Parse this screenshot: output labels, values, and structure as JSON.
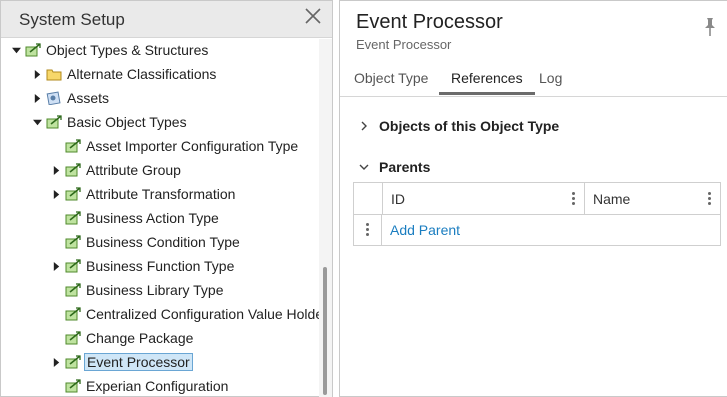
{
  "left": {
    "title": "System Setup",
    "tree": [
      {
        "label": "Object Types & Structures",
        "caret": "down",
        "icon": "object-type-icon"
      },
      {
        "label": "Alternate Classifications",
        "caret": "right",
        "icon": "folder-icon"
      },
      {
        "label": "Assets",
        "caret": "right",
        "icon": "assets-icon"
      },
      {
        "label": "Basic Object Types",
        "caret": "down",
        "icon": "object-type-icon"
      },
      {
        "label": "Asset Importer Configuration Type",
        "caret": "none",
        "icon": "object-type-icon"
      },
      {
        "label": "Attribute Group",
        "caret": "right",
        "icon": "object-type-icon"
      },
      {
        "label": "Attribute Transformation",
        "caret": "right",
        "icon": "object-type-icon"
      },
      {
        "label": "Business Action Type",
        "caret": "none",
        "icon": "object-type-icon"
      },
      {
        "label": "Business Condition Type",
        "caret": "none",
        "icon": "object-type-icon"
      },
      {
        "label": "Business Function Type",
        "caret": "right",
        "icon": "object-type-icon"
      },
      {
        "label": "Business Library Type",
        "caret": "none",
        "icon": "object-type-icon"
      },
      {
        "label": "Centralized Configuration Value Holder",
        "caret": "none",
        "icon": "object-type-icon"
      },
      {
        "label": "Change Package",
        "caret": "none",
        "icon": "object-type-icon"
      },
      {
        "label": "Event Processor",
        "caret": "right",
        "icon": "object-type-icon",
        "selected": true
      },
      {
        "label": "Experian Configuration",
        "caret": "none",
        "icon": "object-type-icon"
      }
    ]
  },
  "right": {
    "title": "Event Processor",
    "subtitle": "Event Processor",
    "tabs": [
      {
        "label": "Object Type",
        "active": false
      },
      {
        "label": "References",
        "active": true
      },
      {
        "label": "Log",
        "active": false
      }
    ],
    "sections": {
      "objects": "Objects of this Object Type",
      "parents": "Parents"
    },
    "grid": {
      "columns": [
        "ID",
        "Name"
      ],
      "add_parent": "Add Parent"
    }
  },
  "colors": {
    "link": "#1a7dc0",
    "selection_bg": "#cfe6f7",
    "selection_border": "#6aa6d4",
    "header_bg": "#eaeaea"
  }
}
